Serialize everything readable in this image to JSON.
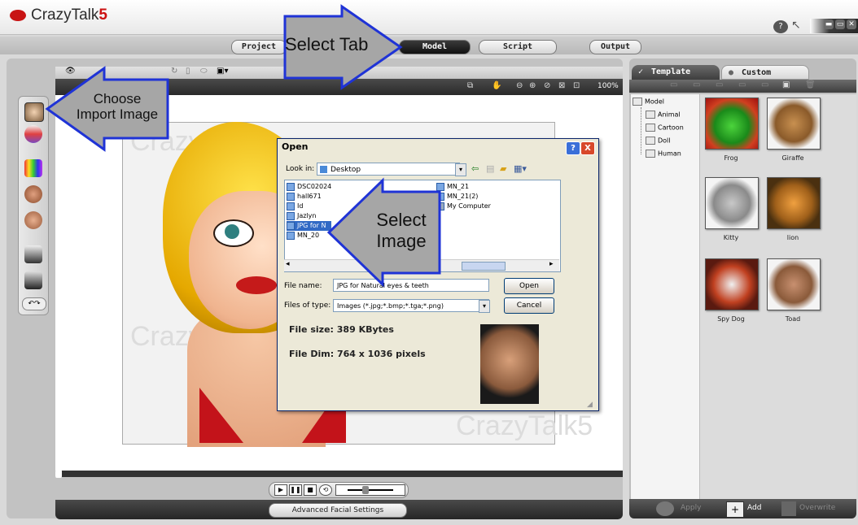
{
  "app": {
    "logo_name": "CrazyTalk",
    "logo_version": "5",
    "help_icon": "?"
  },
  "tabs": [
    {
      "label": "Project"
    },
    {
      "label": "Model"
    },
    {
      "label": "Script"
    },
    {
      "label": "Output"
    }
  ],
  "viewport": {
    "zoom": "100%",
    "watermark": "CrazyTalk5"
  },
  "callouts": {
    "select_tab": "Select Tab",
    "choose_import": [
      "Choose",
      "Import Image"
    ],
    "select_image": [
      "Select",
      "Image"
    ]
  },
  "dialog": {
    "title": "Open",
    "help_btn": "?",
    "close_btn": "X",
    "look_in_label": "Look in:",
    "look_in_value": "Desktop",
    "files_col1": [
      "DSC02024",
      "hall671",
      "Id",
      "Jazlyn",
      "JPG for N",
      "MN_20"
    ],
    "files_col2": [
      "MN_21",
      "MN_21(2)",
      "My Computer"
    ],
    "file_name_label": "File name:",
    "file_name_value": "JPG for Natural eyes & teeth",
    "files_type_label": "Files of type:",
    "files_type_value": "Images (*.jpg;*.bmp;*.tga;*.png)",
    "open_btn": "Open",
    "cancel_btn": "Cancel",
    "file_size_label": "File size:",
    "file_size_value": "389 KBytes",
    "file_dim_label": "File Dim:",
    "file_dim_value": "764 x 1036 pixels"
  },
  "playback": {
    "advanced_button": "Advanced Facial Settings"
  },
  "right_panel": {
    "tab_template": "Template",
    "tab_custom": "Custom",
    "tree": [
      "Model",
      "Animal",
      "Cartoon",
      "Doll",
      "Human"
    ],
    "thumbnails": [
      {
        "label": "Frog"
      },
      {
        "label": "Giraffe"
      },
      {
        "label": "Kitty"
      },
      {
        "label": "lion"
      },
      {
        "label": "Spy Dog"
      },
      {
        "label": "Toad"
      }
    ],
    "apply_label": "Apply",
    "add_label": "Add",
    "overwrite_label": "Overwrite"
  }
}
